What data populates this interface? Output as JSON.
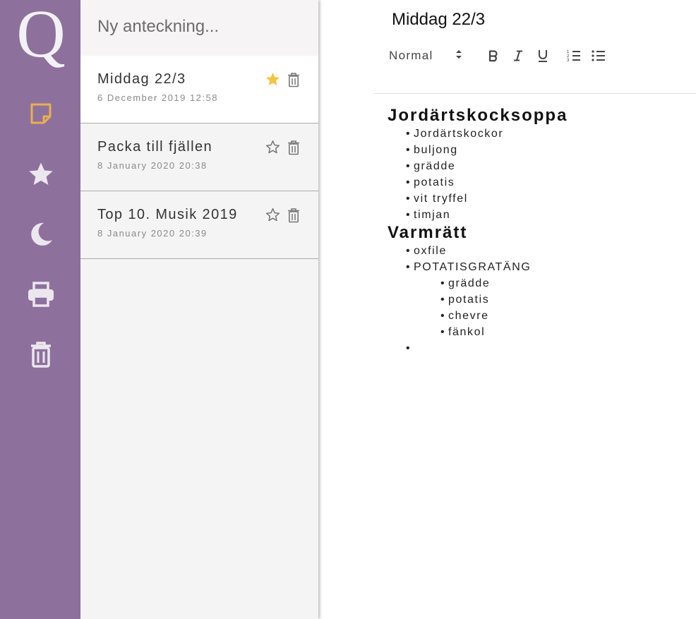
{
  "app": {
    "logo_letter": "Q",
    "accent_color": "#e8b04e",
    "sidebar_color": "#8d719c"
  },
  "sidebar": {
    "items": [
      {
        "icon": "note-icon",
        "active": true
      },
      {
        "icon": "star-icon",
        "active": false
      },
      {
        "icon": "moon-icon",
        "active": false
      },
      {
        "icon": "printer-icon",
        "active": false
      },
      {
        "icon": "trash-icon",
        "active": false
      }
    ]
  },
  "notes_list": {
    "new_note_placeholder": "Ny anteckning...",
    "notes": [
      {
        "title": "Middag 22/3",
        "date": "6 December 2019 12:58",
        "starred": true,
        "active": true
      },
      {
        "title": "Packa till fjällen",
        "date": "8 January 2020 20:38",
        "starred": false,
        "active": false
      },
      {
        "title": "Top 10. Musik 2019",
        "date": "8 January 2020 20:39",
        "starred": false,
        "active": false
      }
    ]
  },
  "editor": {
    "title": "Middag 22/3",
    "toolbar": {
      "format_value": "Normal",
      "buttons": [
        "bold-icon",
        "italic-icon",
        "underline-icon",
        "ordered-list-icon",
        "bullet-list-icon"
      ]
    },
    "content": {
      "sections": [
        {
          "heading": "Jordärtskocksoppa",
          "items": [
            "Jordärtskockor",
            "buljong",
            "grädde",
            "potatis",
            "vit tryffel",
            "timjan"
          ]
        },
        {
          "heading": "Varmrätt",
          "items": [
            "oxfile",
            "POTATISGRATÄNG"
          ],
          "subitems": [
            "grädde",
            "potatis",
            "chevre",
            "fänkol"
          ],
          "trailing_empty_item": ""
        }
      ]
    }
  }
}
